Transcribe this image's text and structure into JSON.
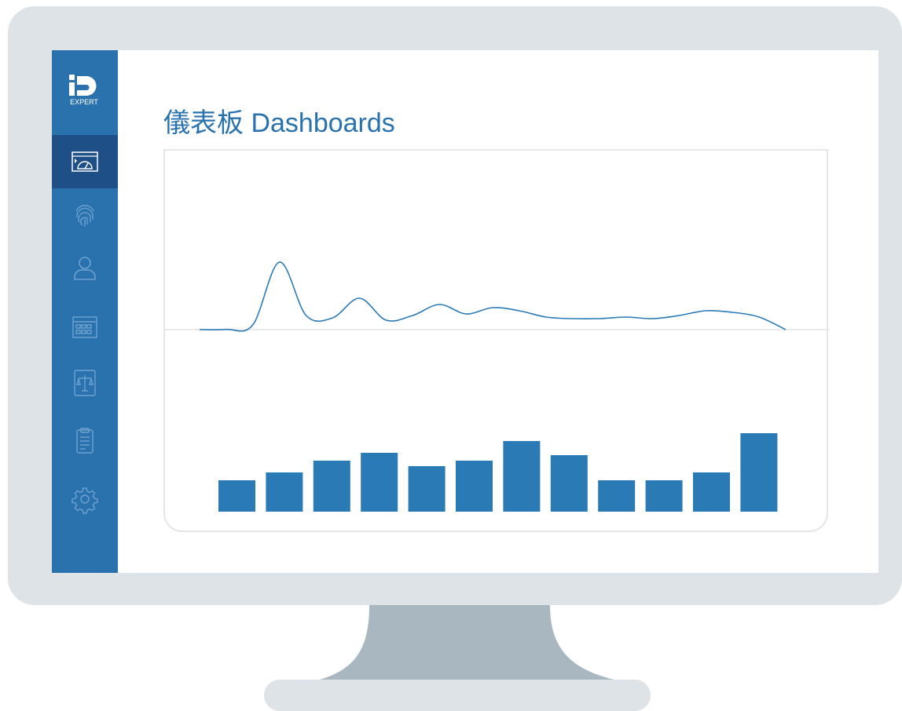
{
  "app": {
    "logo_text": "iD",
    "logo_subtext": "EXPERT"
  },
  "header": {
    "title": "儀表板 Dashboards"
  },
  "sidebar": {
    "items": [
      {
        "icon": "dashboard-icon",
        "active": true
      },
      {
        "icon": "fingerprint-icon",
        "active": false
      },
      {
        "icon": "user-icon",
        "active": false
      },
      {
        "icon": "calendar-icon",
        "active": false
      },
      {
        "icon": "balance-scale-icon",
        "active": false
      },
      {
        "icon": "clipboard-icon",
        "active": false
      },
      {
        "icon": "gear-icon",
        "active": false
      }
    ]
  },
  "colors": {
    "sidebar": "#2a72ae",
    "sidebar_active": "#1e4f86",
    "accent": "#2a7ab5",
    "frame": "#dde3e6",
    "stand": "#a9b7c1"
  },
  "chart_data": [
    {
      "type": "line",
      "series": [
        {
          "values": [
            0,
            0.3,
            6,
            86,
            18,
            15,
            40,
            12,
            18,
            32,
            20,
            28,
            24,
            16,
            14,
            14,
            16,
            14,
            18,
            24,
            22,
            16,
            0
          ]
        }
      ]
    },
    {
      "type": "bar",
      "values": [
        4,
        5,
        6.5,
        7.5,
        5.8,
        6.5,
        9,
        7.2,
        4,
        4,
        5,
        10
      ]
    }
  ]
}
